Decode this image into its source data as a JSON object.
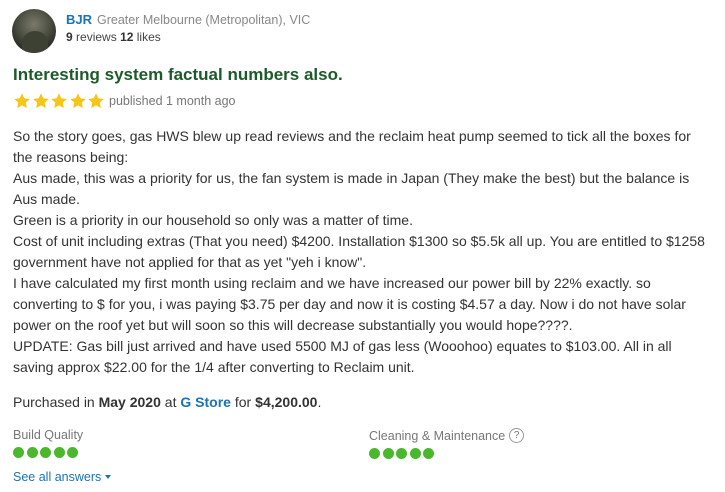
{
  "reviewer": {
    "name": "BJR",
    "location": "Greater Melbourne (Metropolitan), VIC",
    "reviews_count": "9",
    "reviews_label": "reviews",
    "likes_count": "12",
    "likes_label": "likes"
  },
  "review": {
    "title": "Interesting system factual numbers also.",
    "rating": 5,
    "star_color": "#f5c518",
    "published": "published 1 month ago",
    "paragraphs": [
      "So the story goes, gas HWS blew up read reviews and the reclaim heat pump seemed to tick all the boxes for the reasons being:",
      "Aus made, this was a priority for us, the fan system is made in Japan (They make the best) but the balance is Aus made.",
      "Green is a priority in our household so only was a matter of time.",
      "Cost of unit including extras (That you need) $4200. Installation $1300 so $5.5k all up. You are entitled to $1258 government have not applied for that as yet \"yeh i know\".",
      "I have calculated my first month using reclaim and we have increased our power bill by 22% exactly. so converting to $ for you, i was paying $3.75 per day and now it is costing $4.57 a day. Now i do not have solar power on the roof yet but will soon so this will decrease substantially you would hope????.",
      "UPDATE: Gas bill just arrived and have used 5500 MJ of gas less (Wooohoo) equates to $103.00. All in all saving approx $22.00 for the 1/4 after converting to Reclaim unit."
    ],
    "purchase": {
      "prefix": "Purchased in",
      "date": "May 2020",
      "at": "at",
      "store": "G Store",
      "for": "for",
      "price": "$4,200.00",
      "suffix": "."
    }
  },
  "ratings": [
    {
      "label": "Build Quality",
      "score": 5,
      "help": ""
    },
    {
      "label": "Cleaning & Maintenance",
      "score": 5,
      "help": "?"
    }
  ],
  "rating_dot_color": "#49b82c",
  "see_all": "See all answers"
}
